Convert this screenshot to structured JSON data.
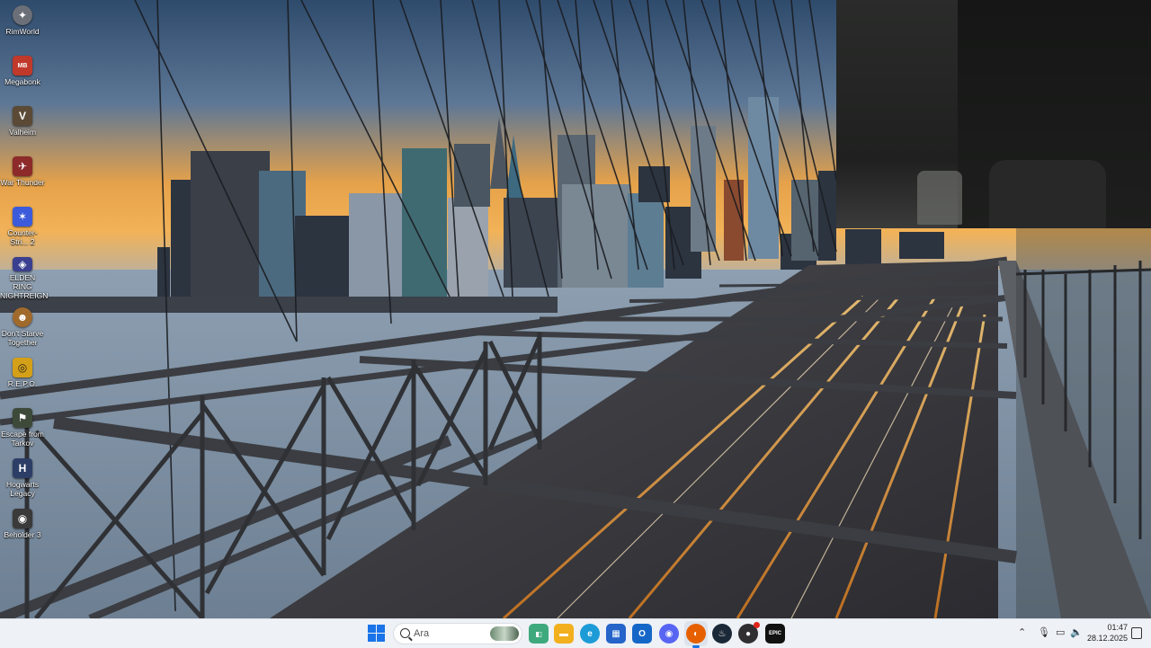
{
  "desktop": {
    "icons": [
      {
        "label": "RimWorld",
        "icon": "rimworld-icon",
        "color": "#6b7078"
      },
      {
        "label": "Megabonk",
        "icon": "megabonk-icon",
        "color": "#c0392b"
      },
      {
        "label": "Valheim",
        "icon": "valheim-icon",
        "color": "#5b4a35"
      },
      {
        "label": "War Thunder",
        "icon": "war-thunder-icon",
        "color": "#8d2a2a"
      },
      {
        "label": "Counter-Stri... 2",
        "icon": "counter-strike-icon",
        "color": "#3b5bdb"
      },
      {
        "label": "ELDEN RING NIGHTREIGN",
        "icon": "elden-ring-icon",
        "color": "#3b3f8f"
      },
      {
        "label": "Don't Starve Together",
        "icon": "dont-starve-icon",
        "color": "#a06a2c"
      },
      {
        "label": "R.E.P.O.",
        "icon": "repo-icon",
        "color": "#d4a017"
      },
      {
        "label": "Escape from Tarkov",
        "icon": "tarkov-icon",
        "color": "#3d4a3a"
      },
      {
        "label": "Hogwarts Legacy",
        "icon": "hogwarts-icon",
        "color": "#2c3e66"
      },
      {
        "label": "Beholder 3",
        "icon": "beholder-icon",
        "color": "#3a3a3a"
      }
    ]
  },
  "taskbar": {
    "search_placeholder": "Ara",
    "apps": [
      {
        "name": "file-explorer-icon",
        "glyph": "▬",
        "color": "#f2b01e"
      },
      {
        "name": "edge-icon",
        "glyph": "e",
        "color": "#1d9bd7"
      },
      {
        "name": "store-icon",
        "glyph": "▦",
        "color": "#2564c9"
      },
      {
        "name": "outlook-icon",
        "glyph": "O",
        "color": "#1567c7"
      },
      {
        "name": "discord-icon",
        "glyph": "◉",
        "color": "#5865f2"
      },
      {
        "name": "firefox-icon",
        "glyph": "◐",
        "color": "#e66000"
      },
      {
        "name": "steam-icon",
        "glyph": "♨",
        "color": "#1b2838"
      },
      {
        "name": "obs-icon",
        "glyph": "●",
        "color": "#302e31"
      },
      {
        "name": "epic-games-icon",
        "glyph": "EPIC",
        "color": "#111111"
      }
    ],
    "clock_time": "01:47",
    "clock_date": "28.12.2025"
  }
}
